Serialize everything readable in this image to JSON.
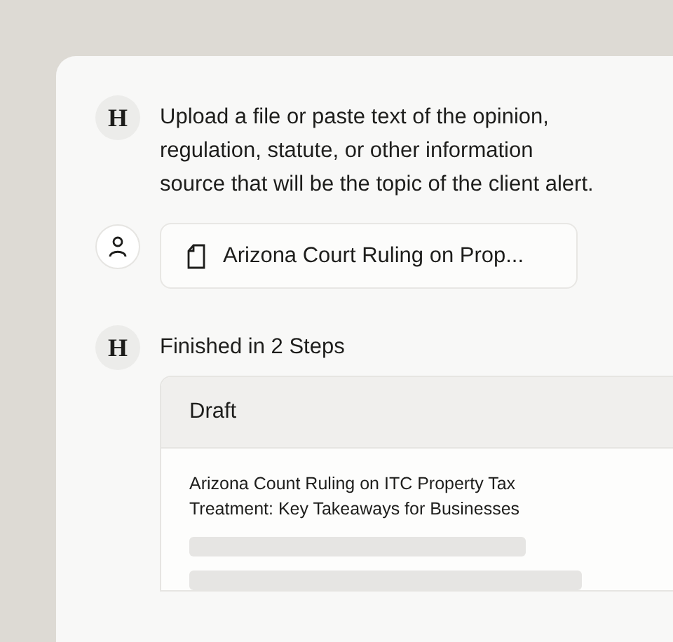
{
  "messages": [
    {
      "kind": "assistant",
      "avatar": "H",
      "text": "Upload a file or paste text of the opinion, regulation, statute, or other information source that will be the topic of the client alert."
    },
    {
      "kind": "user",
      "attachment": "Arizona Court Ruling on Prop..."
    },
    {
      "kind": "assistant",
      "avatar": "H",
      "text": "Finished in 2 Steps",
      "card": {
        "header": "Draft",
        "title": "Arizona Count Ruling on ITC Property Tax Treatment: Key Takeaways for Businesses"
      }
    }
  ]
}
